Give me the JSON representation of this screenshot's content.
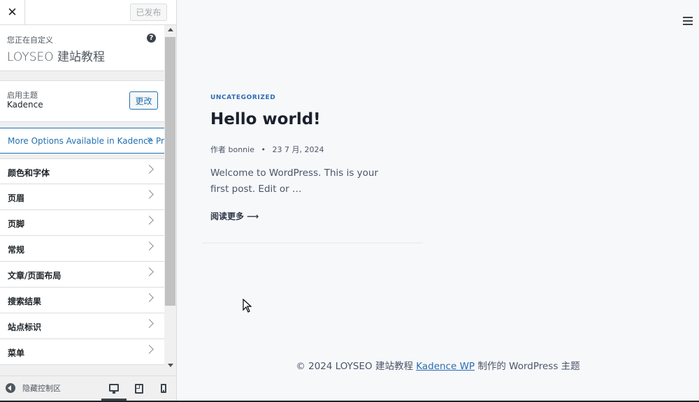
{
  "sidebar": {
    "close_icon": "close-icon",
    "publish_label": "已发布",
    "customizing_label": "您正在自定义",
    "site_title": "LOYSEO 建站教程",
    "help_icon": "help-icon",
    "active_theme_label": "启用主题",
    "theme_name": "Kadence",
    "change_label": "更改",
    "pro_label": "More Options Available in Kadence Pro",
    "items": [
      {
        "label": "颜色和字体"
      },
      {
        "label": "页眉"
      },
      {
        "label": "页脚"
      },
      {
        "label": "常规"
      },
      {
        "label": "文章/页面布局"
      },
      {
        "label": "搜索结果"
      },
      {
        "label": "站点标识"
      },
      {
        "label": "菜单"
      }
    ],
    "collapse_label": "隐藏控制区",
    "devices": [
      "desktop",
      "tablet",
      "mobile"
    ],
    "active_device": "desktop"
  },
  "preview": {
    "post": {
      "category": "UNCATEGORIZED",
      "title": "Hello world!",
      "author_prefix": "作者",
      "author": "bonnie",
      "date": "23 7 月, 2024",
      "excerpt": "Welcome to WordPress. This is your first post. Edit or …",
      "read_more": "阅读更多 ⟶"
    },
    "footer": {
      "prefix": "© 2024 LOYSEO 建站教程 ",
      "link": "Kadence WP",
      "suffix": " 制作的 WordPress 主题"
    }
  },
  "colors": {
    "accent": "#2271b1",
    "link": "#2b6cb0",
    "panel_bg": "#f0f0f1",
    "preview_bg": "#f7f8fa"
  }
}
